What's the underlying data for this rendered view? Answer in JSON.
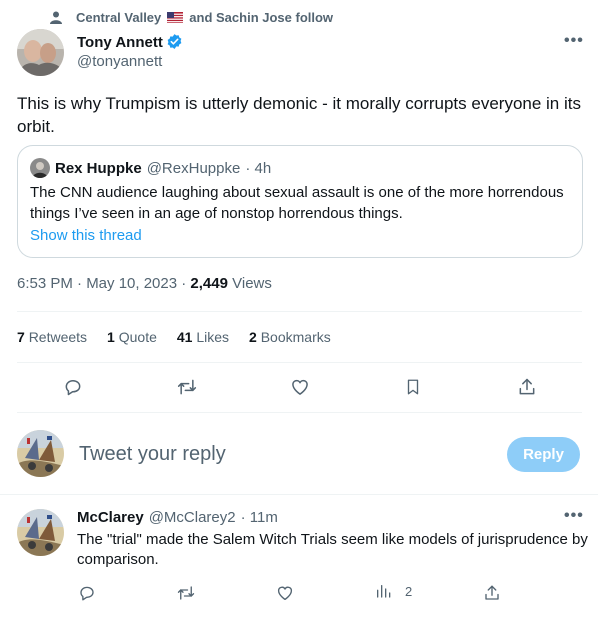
{
  "social_context": {
    "text_before": "Central Valley",
    "text_after": "and Sachin Jose follow"
  },
  "tweet": {
    "author_name": "Tony Annett",
    "author_handle": "@tonyannett",
    "text": "This is why Trumpism is utterly demonic - it morally corrupts everyone in its orbit.",
    "timestamp": "6:53 PM · May 10, 2023 ·",
    "views_count": "2,449",
    "views_label": "Views"
  },
  "quote": {
    "author_name": "Rex Huppke",
    "author_handle": "@RexHuppke",
    "time": "· 4h",
    "text": "The CNN audience laughing about sexual assault is one of the more horrendous things I’ve seen in an age of nonstop horrendous things.",
    "thread_link": "Show this thread"
  },
  "stats": {
    "retweets_count": "7",
    "retweets_label": "Retweets",
    "quotes_count": "1",
    "quotes_label": "Quote",
    "likes_count": "41",
    "likes_label": "Likes",
    "bookmarks_count": "2",
    "bookmarks_label": "Bookmarks"
  },
  "composer": {
    "placeholder": "Tweet your reply",
    "reply_button": "Reply"
  },
  "comment": {
    "author_name": "McClarey",
    "author_handle": "@McClarey2",
    "time": "· 11m",
    "text": "The \"trial\" made the Salem Witch Trials seem like models of jurisprudence by comparison.",
    "analytics_count": "2"
  },
  "icons": {
    "actions": [
      "reply-icon",
      "retweet-icon",
      "like-icon",
      "bookmark-icon",
      "share-icon"
    ],
    "comment_actions": [
      "reply-icon",
      "retweet-icon",
      "like-icon",
      "analytics-icon",
      "share-icon"
    ]
  },
  "colors": {
    "accent": "#1d9bf0",
    "reply_button_disabled": "#8ecdf8",
    "muted_text": "#536471",
    "border": "#cfd9de"
  }
}
